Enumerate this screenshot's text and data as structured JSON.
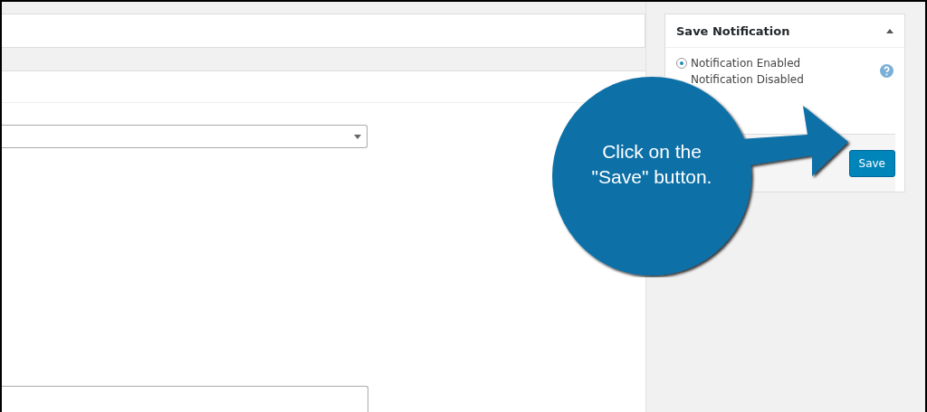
{
  "sidebar_box": {
    "title": "Save Notification",
    "options": [
      {
        "label": "Notification Enabled",
        "selected": true
      },
      {
        "label": "Notification Disabled"
      }
    ],
    "save_button": "Save"
  },
  "callout": {
    "lines": [
      "Click on the",
      "\"Save\" button."
    ]
  }
}
